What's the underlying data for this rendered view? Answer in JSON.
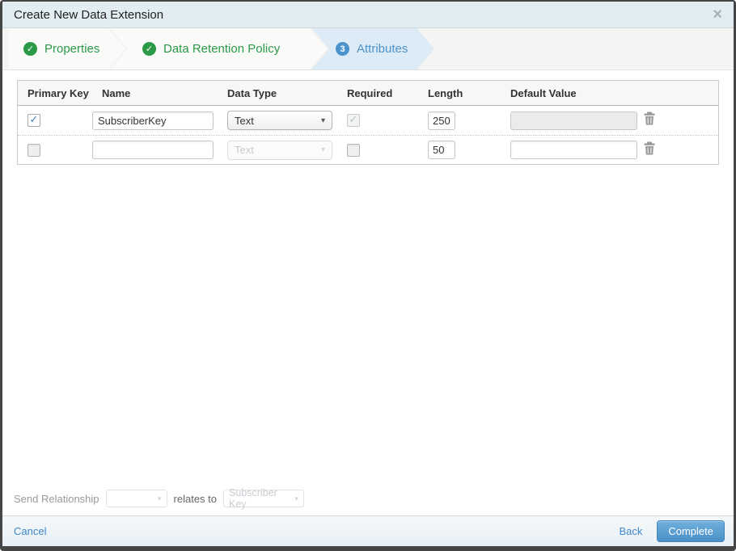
{
  "dialog": {
    "title": "Create New Data Extension"
  },
  "icons": {
    "close_glyph": "×",
    "check_glyph": "✓",
    "dropdown_arrow": "▾"
  },
  "wizard": {
    "steps": [
      {
        "label": "Properties",
        "state": "complete"
      },
      {
        "label": "Data Retention Policy",
        "state": "complete"
      },
      {
        "label": "Attributes",
        "state": "current",
        "number": "3"
      }
    ]
  },
  "attributes_table": {
    "columns": {
      "primary_key": "Primary Key",
      "name": "Name",
      "data_type": "Data Type",
      "required": "Required",
      "length": "Length",
      "default_value": "Default Value"
    },
    "rows": [
      {
        "primary_key_checked": true,
        "name": "SubscriberKey",
        "data_type": "Text",
        "data_type_disabled": false,
        "required_checked": true,
        "required_disabled": true,
        "length": "250",
        "default_value": "",
        "default_value_disabled": true
      },
      {
        "primary_key_checked": false,
        "name": "",
        "data_type": "Text",
        "data_type_disabled": true,
        "required_checked": false,
        "required_disabled": false,
        "length": "50",
        "default_value": "",
        "default_value_disabled": false
      }
    ]
  },
  "send_relationship": {
    "label": "Send Relationship",
    "field_value": "",
    "relates_to": "relates to",
    "target_value": "Subscriber Key"
  },
  "footer": {
    "cancel": "Cancel",
    "back": "Back",
    "complete": "Complete"
  },
  "colors": {
    "accent_blue": "#4a90c9",
    "success_green": "#2b9a47",
    "titlebar_bg": "#e2edf2",
    "step_active_bg": "#dcebf5"
  }
}
